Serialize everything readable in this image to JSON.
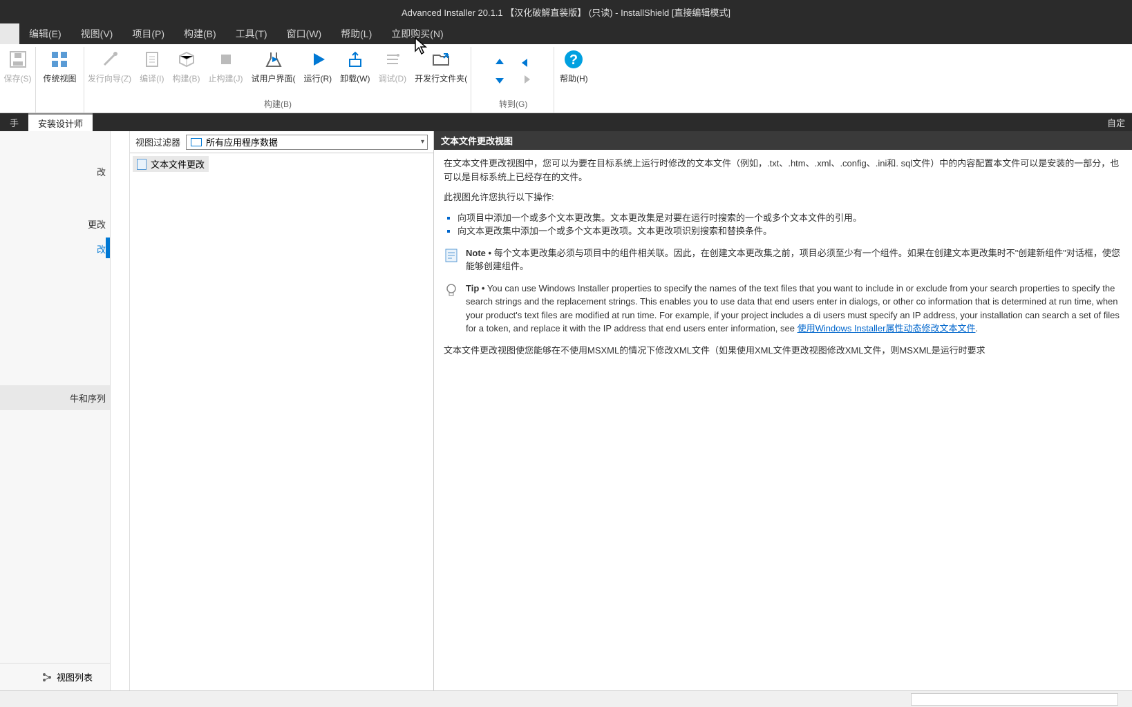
{
  "title": "Advanced Installer 20.1.1 【汉化破解直装版】 (只读) - InstallShield [直接编辑模式]",
  "menu": {
    "items": [
      "",
      "编辑(E)",
      "视图(V)",
      "项目(P)",
      "构建(B)",
      "工具(T)",
      "窗口(W)",
      "帮助(L)",
      "立即购买(N)"
    ]
  },
  "ribbon": {
    "save": "保存(S)",
    "traditional": "传统视图",
    "wizard": "发行向导(Z)",
    "compile": "编译(I)",
    "build": "构建(B)",
    "stop_build": "止构建(J)",
    "test_ui": "试用户界面(",
    "run": "运行(R)",
    "uninstall": "卸载(W)",
    "debug": "调试(D)",
    "open_folder": "开发行文件夹(",
    "help": "帮助(H)",
    "group_build": "构建(B)",
    "group_goto": "转到(G)"
  },
  "tabs": {
    "assistant": "手",
    "designer": "安装设计师",
    "custom": "自定"
  },
  "sidebar": {
    "items": [
      "改",
      "更改",
      "改"
    ],
    "and_sequence": "牛和序列",
    "view_list": "视图列表"
  },
  "filter": {
    "label": "视图过滤器",
    "value": "所有应用程序数据"
  },
  "tree": {
    "item": "文本文件更改"
  },
  "content": {
    "header": "文本文件更改视图",
    "p1": "在文本文件更改视图中，您可以为要在目标系统上运行时修改的文本文件（例如，.txt、.htm、.xml、.config、.ini和. sql文件）中的内容配置本文件可以是安装的一部分，也可以是目标系统上已经存在的文件。",
    "p2": "此视图允许您执行以下操作:",
    "li1": "向项目中添加一个或多个文本更改集。文本更改集是对要在运行时搜索的一个或多个文本文件的引用。",
    "li2": "向文本更改集中添加一个或多个文本更改项。文本更改项识别搜索和替换条件。",
    "note_title": "Note •",
    "note_body": "每个文本更改集必须与项目中的组件相关联。因此，在创建文本更改集之前，项目必须至少有一个组件。如果在创建文本更改集时不\"创建新组件\"对话框，使您能够创建组件。",
    "tip_title": "Tip •",
    "tip_body": "You can use Windows Installer properties to specify the names of the text files that you want to include in or exclude from your search properties to specify the search strings and the replacement strings. This enables you to use data that end users enter in dialogs, or other co information that is determined at run time, when your product's text files are modified at run time. For example, if your project includes a di users must specify an IP address, your installation can search a set of files for a token, and replace it with the IP address that end users enter information, see ",
    "tip_link": "使用Windows Installer属性动态修改文本文件",
    "p3": "文本文件更改视图使您能够在不使用MSXML的情况下修改XML文件（如果使用XML文件更改视图修改XML文件，则MSXML是运行时要求"
  }
}
